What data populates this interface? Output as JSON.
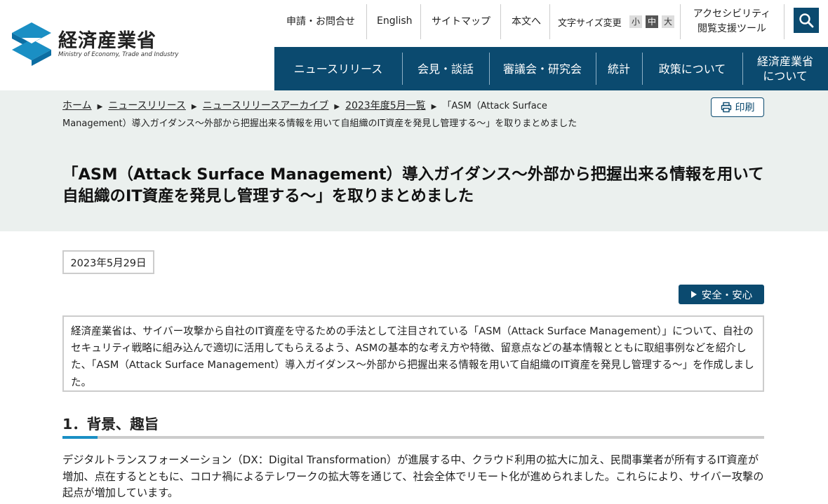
{
  "header": {
    "logo_jp": "経済産業省",
    "logo_en": "Ministry of Economy, Trade and Industry",
    "util": {
      "contact": "申請・お問合せ",
      "english": "English",
      "sitemap": "サイトマップ",
      "skip": "本文へ",
      "font_size_label": "文字サイズ変更",
      "font_small": "小",
      "font_medium": "中",
      "font_large": "大",
      "accessibility_line1": "アクセシビリティ",
      "accessibility_line2": "閲覧支援ツール"
    },
    "nav": {
      "news": "ニュースリリース",
      "press": "会見・談話",
      "council": "審議会・研究会",
      "stats": "統計",
      "policy": "政策について",
      "about_line1": "経済産業省",
      "about_line2": "について"
    }
  },
  "breadcrumb": {
    "home": "ホーム",
    "news": "ニュースリリース",
    "archive": "ニュースリリースアーカイブ",
    "month": "2023年度5月一覧",
    "current": "「ASM（Attack Surface Management）導入ガイダンス～外部から把握出来る情報を用いて自組織のIT資産を発見し管理する～」を取りまとめました"
  },
  "print_label": "印刷",
  "page_title": "「ASM（Attack Surface Management）導入ガイダンス～外部から把握出来る情報を用いて自組織のIT資産を発見し管理する～」を取りまとめました",
  "date": "2023年5月29日",
  "tag": "安全・安心",
  "summary": "経済産業省は、サイバー攻撃から自社のIT資産を守るための手法として注目されている「ASM（Attack Surface Management）」について、自社のセキュリティ戦略に組み込んで適切に活用してもらえるよう、ASMの基本的な考え方や特徴、留意点などの基本情報とともに取組事例などを紹介した、「ASM（Attack Surface Management）導入ガイダンス～外部から把握出来る情報を用いて自組織のIT資産を発見し管理する～」を作成しました。",
  "section1": {
    "heading": "1．背景、趣旨",
    "body": "デジタルトランスフォーメーション（DX：Digital Transformation）が進展する中、クラウド利用の拡大に加え、民間事業者が所有するIT資産が増加、点在するとともに、コロナ禍によるテレワークの拡大等を通じて、社会全体でリモート化が進められました。これらにより、サイバー攻撃の起点が増加しています。"
  },
  "colors": {
    "brand": "#0b4a6f",
    "band_bg": "#ebf0ee",
    "accent": "#1a8fc4"
  },
  "icons": [
    "logo-mark-icon",
    "search-icon",
    "printer-icon",
    "triangle-right-icon"
  ]
}
